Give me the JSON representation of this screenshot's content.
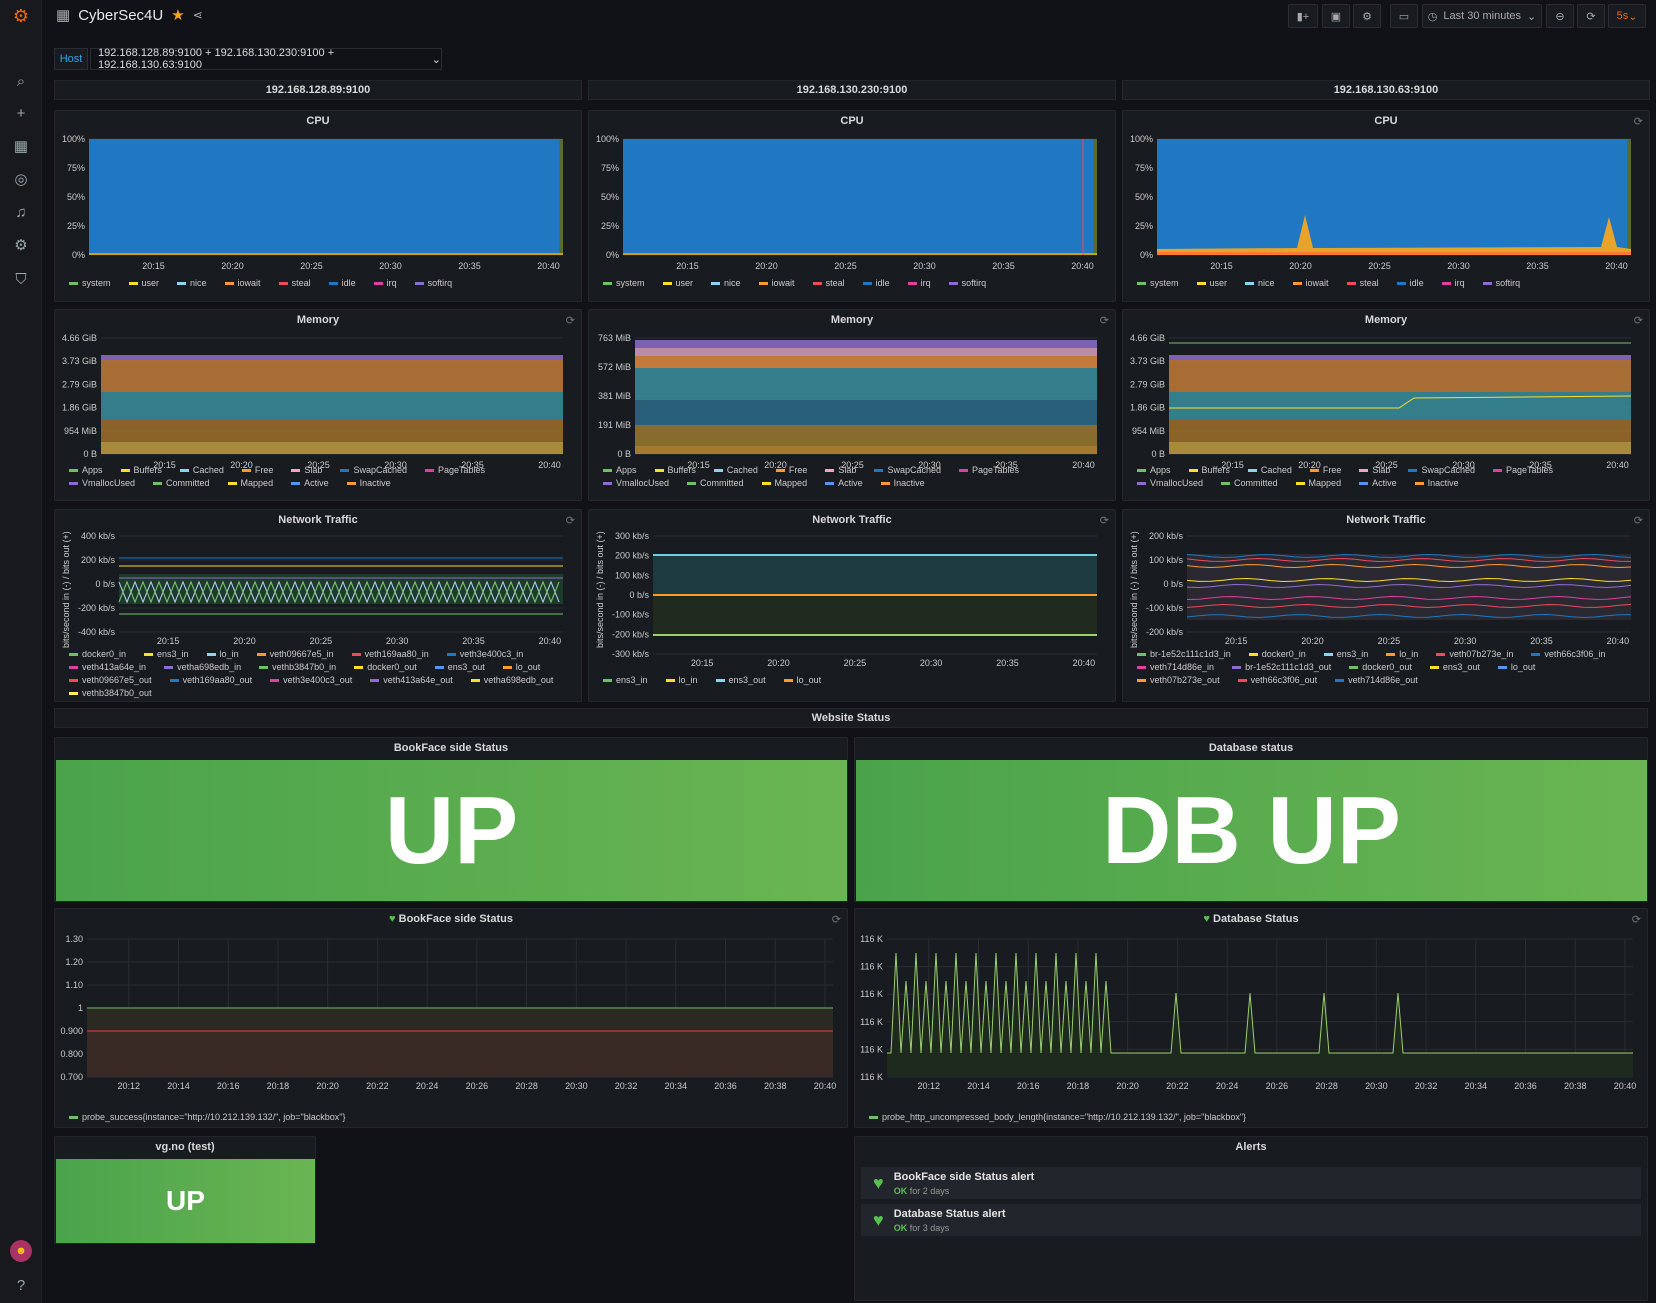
{
  "dashboard": {
    "title": "CyberSec4U"
  },
  "toolbar": {
    "time_range": "Last 30 minutes",
    "refresh": "5s"
  },
  "variable": {
    "label": "Host",
    "value": "192.168.128.89:9100 + 192.168.130.230:9100 + 192.168.130.63:9100"
  },
  "hosts": [
    "192.168.128.89:9100",
    "192.168.130.230:9100",
    "192.168.130.63:9100"
  ],
  "panels": {
    "cpu": "CPU",
    "memory": "Memory",
    "network": "Network Traffic",
    "network_ylabel": "bits/second in (-) / bits out (+)"
  },
  "time_ticks": [
    "20:15",
    "20:20",
    "20:25",
    "20:30",
    "20:35",
    "20:40"
  ],
  "cpu_legend": [
    "system",
    "user",
    "nice",
    "iowait",
    "steal",
    "idle",
    "irq",
    "softirq"
  ],
  "cpu_yticks": [
    "100%",
    "75%",
    "50%",
    "25%",
    "0%"
  ],
  "mem_legend": [
    "Apps",
    "Buffers",
    "Cached",
    "Free",
    "Slab",
    "SwapCached",
    "PageTables",
    "VmallocUsed",
    "Committed",
    "Mapped",
    "Active",
    "Inactive"
  ],
  "mem_yticks": [
    [
      "4.66 GiB",
      "3.73 GiB",
      "2.79 GiB",
      "1.86 GiB",
      "954 MiB",
      "0 B"
    ],
    [
      "763 MiB",
      "572 MiB",
      "381 MiB",
      "191 MiB",
      "0 B"
    ],
    [
      "4.66 GiB",
      "3.73 GiB",
      "2.79 GiB",
      "1.86 GiB",
      "954 MiB",
      "0 B"
    ]
  ],
  "net_yticks": [
    [
      "400 kb/s",
      "200 kb/s",
      "0 b/s",
      "-200 kb/s",
      "-400 kb/s"
    ],
    [
      "300 kb/s",
      "200 kb/s",
      "100 kb/s",
      "0 b/s",
      "-100 kb/s",
      "-200 kb/s",
      "-300 kb/s"
    ],
    [
      "200 kb/s",
      "100 kb/s",
      "0 b/s",
      "-100 kb/s",
      "-200 kb/s"
    ]
  ],
  "net_legend": [
    [
      "docker0_in",
      "ens3_in",
      "lo_in",
      "veth09667e5_in",
      "veth169aa80_in",
      "veth3e400c3_in",
      "veth413a64e_in",
      "vetha698edb_in",
      "vethb3847b0_in",
      "docker0_out",
      "ens3_out",
      "lo_out",
      "veth09667e5_out",
      "veth169aa80_out",
      "veth3e400c3_out",
      "veth413a64e_out",
      "vetha698edb_out",
      "vethb3847b0_out"
    ],
    [
      "ens3_in",
      "lo_in",
      "ens3_out",
      "lo_out"
    ],
    [
      "br-1e52c111c1d3_in",
      "docker0_in",
      "ens3_in",
      "lo_in",
      "veth07b273e_in",
      "veth66c3f06_in",
      "veth714d86e_in",
      "br-1e52c111c1d3_out",
      "docker0_out",
      "ens3_out",
      "lo_out",
      "veth07b273e_out",
      "veth66c3f06_out",
      "veth714d86e_out"
    ]
  ],
  "website_status": {
    "row_title": "Website Status",
    "bookface_title": "BookFace side Status",
    "bookface_value": "UP",
    "db_title": "Database status",
    "db_value": "DB UP",
    "vg_title": "vg.no (test)",
    "vg_value": "UP"
  },
  "bookface_graph": {
    "title": "BookFace side Status",
    "yticks": [
      "1.30",
      "1.20",
      "1.10",
      "1",
      "0.900",
      "0.800",
      "0.700"
    ],
    "xticks": [
      "20:12",
      "20:14",
      "20:16",
      "20:18",
      "20:20",
      "20:22",
      "20:24",
      "20:26",
      "20:28",
      "20:30",
      "20:32",
      "20:34",
      "20:36",
      "20:38",
      "20:40"
    ],
    "legend": "probe_success{instance=\"http://10.212.139.132/\", job=\"blackbox\"}"
  },
  "db_graph": {
    "title": "Database Status",
    "yticks": [
      "116 K",
      "116 K",
      "116 K",
      "116 K",
      "116 K",
      "116 K"
    ],
    "xticks": [
      "20:12",
      "20:14",
      "20:16",
      "20:18",
      "20:20",
      "20:22",
      "20:24",
      "20:26",
      "20:28",
      "20:30",
      "20:32",
      "20:34",
      "20:36",
      "20:38",
      "20:40"
    ],
    "legend": "probe_http_uncompressed_body_length{instance=\"http://10.212.139.132/\", job=\"blackbox\"}"
  },
  "alerts": {
    "title": "Alerts",
    "items": [
      {
        "name": "BookFace side Status alert",
        "state": "OK",
        "duration": "for 2 days"
      },
      {
        "name": "Database Status alert",
        "state": "OK",
        "duration": "for 3 days"
      }
    ]
  },
  "colors": {
    "green": "#73bf69",
    "yellow": "#fade2a",
    "cyan": "#5794f2",
    "orange": "#ff9830",
    "red": "#f2495c",
    "blue": "#1f78c1",
    "pink": "#e040a0",
    "purple": "#8f6dd0",
    "stat_green": "#56a64b"
  }
}
